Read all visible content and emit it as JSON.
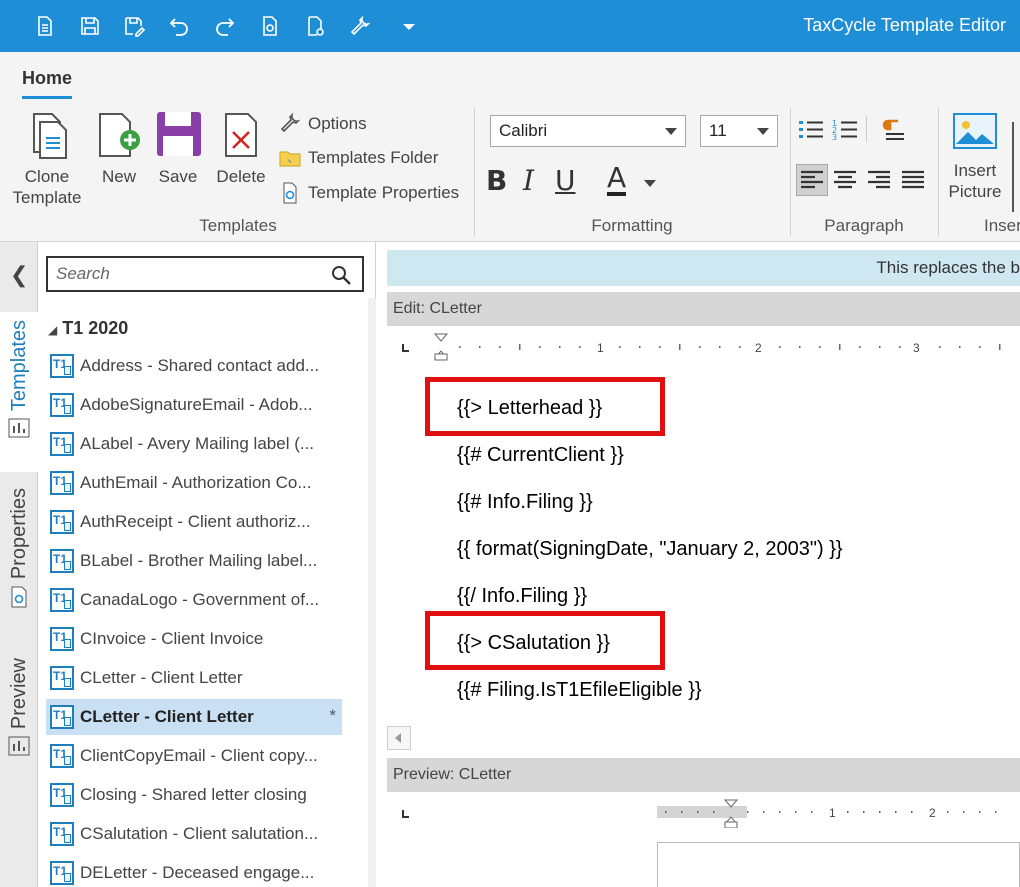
{
  "app": {
    "title": "TaxCycle Template Editor"
  },
  "ribbon": {
    "tab": "Home",
    "templates": {
      "clone": "Clone Template",
      "new": "New",
      "save": "Save",
      "delete": "Delete",
      "options": "Options",
      "folder": "Templates Folder",
      "properties": "Template Properties",
      "group_label": "Templates"
    },
    "formatting": {
      "font": "Calibri",
      "size": "11",
      "bold": "B",
      "italic": "I",
      "underline": "U",
      "color": "A",
      "group_label": "Formatting"
    },
    "paragraph": {
      "group_label": "Paragraph"
    },
    "insert": {
      "picture": "Insert Picture",
      "group_label": "Inser"
    }
  },
  "sidebar": {
    "tabs": [
      "Templates",
      "Properties",
      "Preview"
    ],
    "search_placeholder": "Search",
    "group": "T1 2020",
    "items": [
      "Address - Shared contact add...",
      "AdobeSignatureEmail - Adob...",
      "ALabel - Avery Mailing label (...",
      "AuthEmail - Authorization Co...",
      "AuthReceipt - Client authoriz...",
      "BLabel - Brother Mailing label...",
      "CanadaLogo - Government of...",
      "CInvoice - Client Invoice",
      "CLetter - Client Letter",
      "CLetter - Client Letter",
      "ClientCopyEmail - Client copy...",
      "Closing - Shared letter closing",
      "CSalutation - Client salutation...",
      "DELetter - Deceased engage..."
    ],
    "selected_star": "*"
  },
  "editor": {
    "banner": "This replaces the b",
    "edit_header": "Edit: CLetter",
    "ruler_numbers": [
      "1",
      "2",
      "3"
    ],
    "lines": [
      "{{> Letterhead }}",
      "{{# CurrentClient }}",
      "{{# Info.Filing }}",
      "{{ format(SigningDate, \"January 2, 2003\") }}",
      "{{/ Info.Filing }}",
      "{{> CSalutation }}",
      "{{# Filing.IsT1EfileEligible }}"
    ],
    "preview_header": "Preview: CLetter",
    "preview_ruler_numbers": [
      "1",
      "2"
    ]
  },
  "colors": {
    "accent": "#1e8fd6",
    "highlight": "#e01010",
    "selected": "#c9dff3",
    "banner": "#cfe7f1"
  }
}
